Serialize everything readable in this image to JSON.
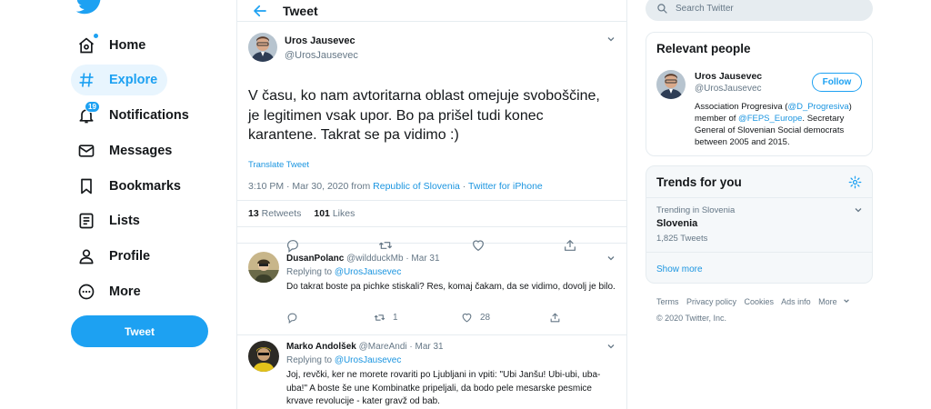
{
  "nav": {
    "items": [
      {
        "label": "Home",
        "icon": "home-icon"
      },
      {
        "label": "Explore",
        "icon": "hashtag-icon"
      },
      {
        "label": "Notifications",
        "icon": "bell-icon",
        "badge": "19"
      },
      {
        "label": "Messages",
        "icon": "envelope-icon"
      },
      {
        "label": "Bookmarks",
        "icon": "bookmark-icon"
      },
      {
        "label": "Lists",
        "icon": "list-icon"
      },
      {
        "label": "Profile",
        "icon": "person-icon"
      },
      {
        "label": "More",
        "icon": "more-circle-icon"
      }
    ],
    "tweet_button": "Tweet"
  },
  "header": {
    "title": "Tweet"
  },
  "focal_tweet": {
    "name": "Uros Jausevec",
    "handle": "@UrosJausevec",
    "text": "V času, ko nam avtoritarna oblast omejuje svoboščine, je legitimen vsak upor. Bo pa prišel tudi konec karantene. Takrat se pa vidimo :)",
    "translate": "Translate Tweet",
    "time": "3:10 PM · Mar 30, 2020 from ",
    "location": "Republic of Slovenia",
    "separator": " · ",
    "source": "Twitter for iPhone",
    "retweets": "13",
    "retweets_label": " Retweets",
    "likes": "101",
    "likes_label": " Likes"
  },
  "replies": [
    {
      "name": "DusanPolanc",
      "handle": "@wildduckMb",
      "date": " · Mar 31",
      "replying_prefix": "Replying to ",
      "replying_to": "@UrosJausevec",
      "text": "Do takrat boste pa pichke stiskali? Res, komaj čakam, da se vidimo, dovolj je bilo.",
      "retweets": "1",
      "likes": "28"
    },
    {
      "name": "Marko Andolšek",
      "handle": "@MareAndi",
      "date": " · Mar 31",
      "replying_prefix": "Replying to ",
      "replying_to": "@UrosJausevec",
      "text": "Joj, revčki, ker ne morete rovariti po Ljubljani in vpiti: \"Ubi Janšu! Ubi-ubi, uba-uba!\" A boste še une Kombinatke pripeljali, da bodo pele mesarske pesmice krvave revolucije - kater gravž od bab."
    }
  ],
  "search": {
    "placeholder": "Search Twitter"
  },
  "relevant": {
    "title": "Relevant people",
    "name": "Uros Jausevec",
    "handle": "@UrosJausevec",
    "follow": "Follow",
    "bio_1": "Association Progresiva (",
    "bio_link1": "@D_Progresiva",
    "bio_2": ") member of ",
    "bio_link2": "@FEPS_Europe",
    "bio_3": ". Secretary General of Slovenian Social democrats between 2005 and 2015."
  },
  "trends": {
    "title": "Trends for you",
    "context": "Trending in Slovenia",
    "name": "Slovenia",
    "count": "1,825 Tweets",
    "show_more": "Show more"
  },
  "footer": {
    "links": [
      "Terms",
      "Privacy policy",
      "Cookies",
      "Ads info",
      "More"
    ],
    "copyright": "© 2020 Twitter, Inc."
  },
  "colors": {
    "accent": "#1da1f2",
    "text": "#14171a",
    "muted": "#657786",
    "border": "#e6ecf0"
  }
}
